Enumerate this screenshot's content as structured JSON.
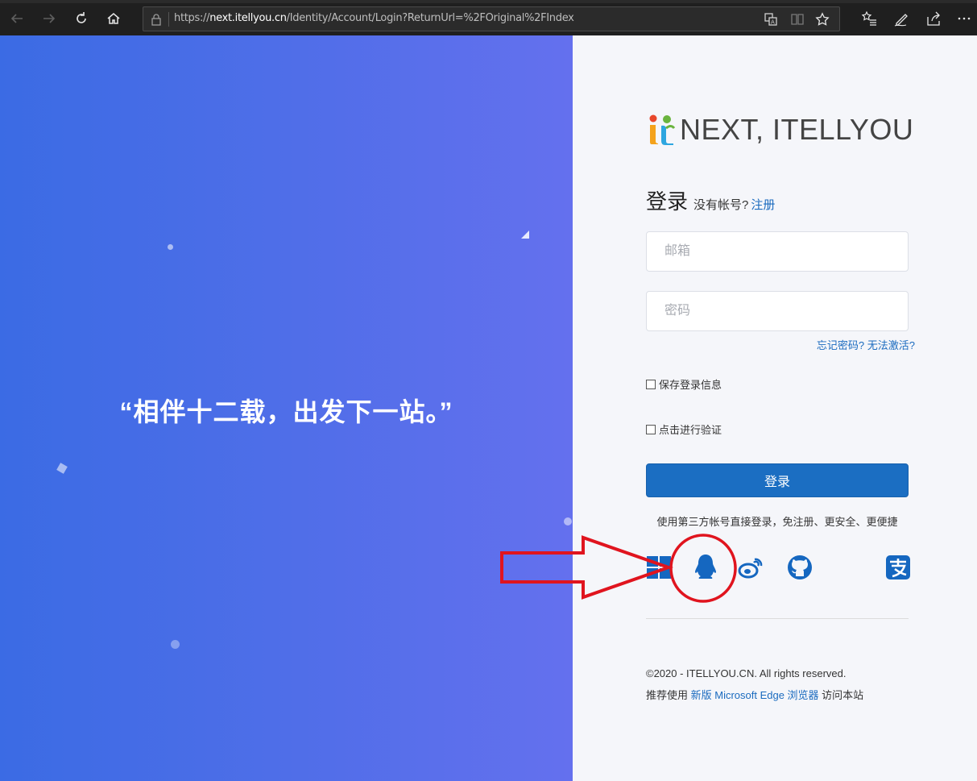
{
  "browser": {
    "url_prefix": "https://",
    "url_host": "next.itellyou.cn",
    "url_path": "/Identity/Account/Login?ReturnUrl=%2FOriginal%2FIndex"
  },
  "hero": {
    "quote": "“相伴十二载，出发下一站。”"
  },
  "brand": {
    "name": "NEXT, ITELLYOU"
  },
  "login": {
    "title": "登录",
    "no_account": "没有帐号?",
    "register_link": "注册",
    "email_placeholder": "邮箱",
    "password_placeholder": "密码",
    "forgot_password": "忘记密码?",
    "cannot_activate": "无法激活?",
    "remember_label": "保存登录信息",
    "verify_label": "点击进行验证",
    "submit_label": "登录",
    "third_party_text": "使用第三方帐号直接登录，免注册、更安全、更便捷"
  },
  "social_icons": [
    "windows-icon",
    "qq-icon",
    "weibo-icon",
    "github-icon",
    "alipay-icon"
  ],
  "footer": {
    "copyright": "©2020 - ITELLYOU.CN. All rights reserved.",
    "recommend_prefix": "推荐使用 ",
    "recommend_link": "新版 Microsoft Edge 浏览器",
    "recommend_suffix": " 访问本站"
  },
  "colors": {
    "hero_start": "#3b6be4",
    "hero_end": "#6470ee",
    "primary": "#1b6ec2",
    "link": "#1b6bbf",
    "annotation": "#e0141e"
  }
}
